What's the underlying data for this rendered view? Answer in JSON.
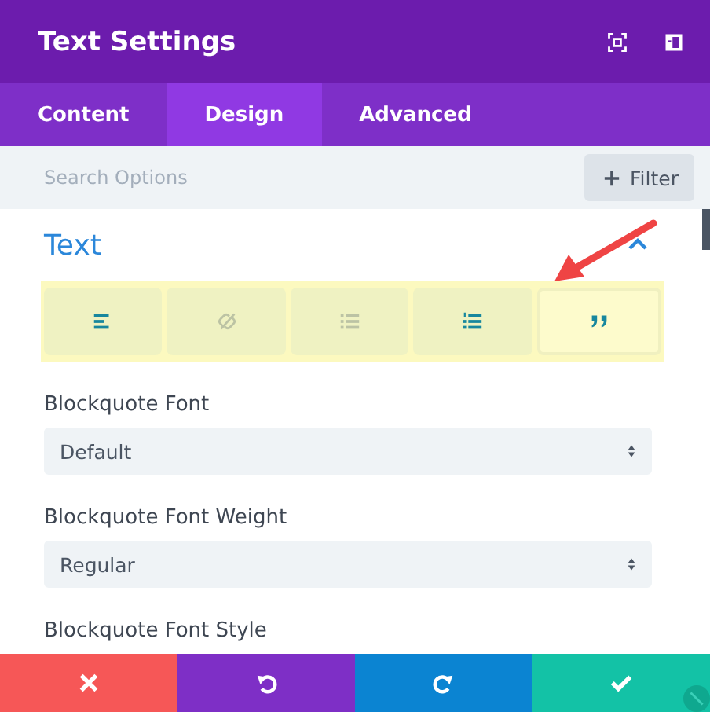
{
  "window": {
    "title": "Text Settings"
  },
  "header_icons": [
    {
      "kind": "focus"
    },
    {
      "kind": "sidebar"
    }
  ],
  "tabs": [
    {
      "label": "Content",
      "selected": false
    },
    {
      "label": "Design",
      "selected": true
    },
    {
      "label": "Advanced",
      "selected": false
    }
  ],
  "search": {
    "placeholder": "Search Options"
  },
  "filter_button": {
    "label": "Filter"
  },
  "section": {
    "title": "Text",
    "expanded": true
  },
  "text_buttons": [
    {
      "kind": "align-left",
      "selected": false,
      "disabled": false
    },
    {
      "kind": "link",
      "selected": false,
      "disabled": true
    },
    {
      "kind": "list",
      "selected": false,
      "disabled": true
    },
    {
      "kind": "ordered-list",
      "selected": false,
      "disabled": false
    },
    {
      "kind": "quote",
      "selected": true,
      "disabled": false
    }
  ],
  "fields": [
    {
      "label": "Blockquote Font",
      "value": "Default"
    },
    {
      "label": "Blockquote Font Weight",
      "value": "Regular"
    },
    {
      "label": "Blockquote Font Style"
    }
  ],
  "annotations": [
    {
      "kind": "arrow"
    }
  ],
  "footer_buttons": [
    {
      "kind": "cancel"
    },
    {
      "kind": "undo"
    },
    {
      "kind": "redo"
    },
    {
      "kind": "save"
    }
  ]
}
